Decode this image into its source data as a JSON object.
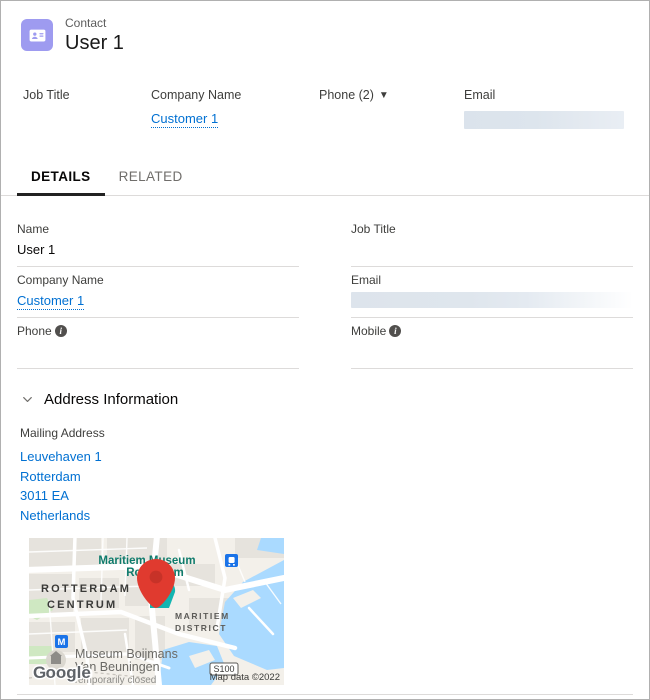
{
  "header": {
    "object_type": "Contact",
    "record_name": "User 1",
    "icon": "contact-card-icon",
    "icon_color": "#9e9bf0"
  },
  "highlights_fields": [
    {
      "label": "Job Title",
      "value": "",
      "type": "text"
    },
    {
      "label": "Company Name",
      "value": "Customer 1",
      "type": "link"
    },
    {
      "label": "Phone (2)",
      "value": "",
      "type": "dropdown",
      "caret": "▼"
    },
    {
      "label": "Email",
      "value": "",
      "type": "redacted"
    }
  ],
  "tabs": [
    {
      "label": "DETAILS",
      "active": true
    },
    {
      "label": "RELATED",
      "active": false
    }
  ],
  "detail_fields": {
    "left": [
      {
        "label": "Name",
        "value": "User 1",
        "type": "text"
      },
      {
        "label": "Company Name",
        "value": "Customer 1",
        "type": "link"
      },
      {
        "label": "Phone",
        "value": "",
        "type": "text",
        "info": true
      }
    ],
    "right": [
      {
        "label": "Job Title",
        "value": "",
        "type": "text"
      },
      {
        "label": "Email",
        "value": "",
        "type": "redacted"
      },
      {
        "label": "Mobile",
        "value": "",
        "type": "text",
        "info": true
      }
    ]
  },
  "address_section": {
    "title": "Address Information",
    "collapse_icon": "chevron-down-icon",
    "field_label": "Mailing Address",
    "lines": [
      "Leuvehaven 1",
      "Rotterdam",
      "3011 EA",
      "Netherlands"
    ]
  },
  "map": {
    "provider": "Google",
    "attribution": "Map data ©2022",
    "labels": {
      "museum_top_1": "Maritiem Museum",
      "museum_top_2": "Rotterdam",
      "district_left_1": "ROTTERDAM",
      "district_left_2": "CENTRUM",
      "district_right_1": "MARITIEM",
      "district_right_2": "DISTRICT",
      "museum_bottom_1": "Museum Boijmans",
      "museum_bottom_2": "Van Beuningen",
      "museum_bottom_3": "Temporarily closed",
      "road_shield": "S100",
      "metro_marker": "M",
      "train_marker": "🚆"
    },
    "pin_color": "#e03a2f",
    "marker_secondary_color": "#13b5b1",
    "water_color": "#aadaff",
    "land_color": "#f2efe9"
  },
  "colors": {
    "link": "#0070d2",
    "label_text": "#3e3e3c",
    "value_text": "#080707",
    "divider": "#dddbda",
    "tab_active_underline": "#222222"
  }
}
